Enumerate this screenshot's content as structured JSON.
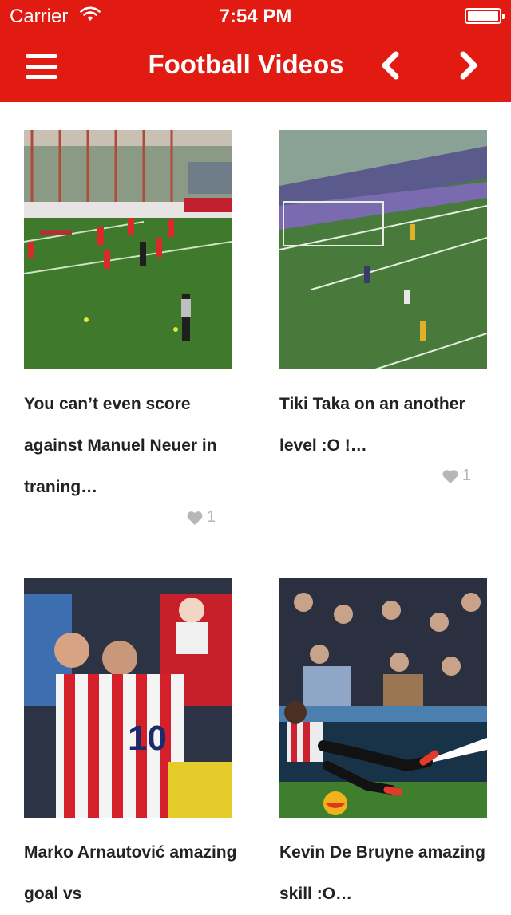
{
  "status_bar": {
    "carrier": "Carrier",
    "time": "7:54 PM"
  },
  "nav": {
    "title": "Football Videos",
    "menu_icon": "hamburger-icon",
    "prev_icon": "chevron-left-icon",
    "next_icon": "chevron-right-icon"
  },
  "videos": [
    {
      "title": "You can’t even score against Manuel Neuer in traning…",
      "likes": "1"
    },
    {
      "title": "Tiki Taka on an another level :O !…",
      "likes": "1"
    },
    {
      "title": "Marko Arnautović amazing goal vs",
      "likes": ""
    },
    {
      "title": "Kevin De Bruyne amazing skill :O…",
      "likes": ""
    }
  ],
  "colors": {
    "brand_red": "#e21b12",
    "like_gray": "#b7b7b7"
  }
}
